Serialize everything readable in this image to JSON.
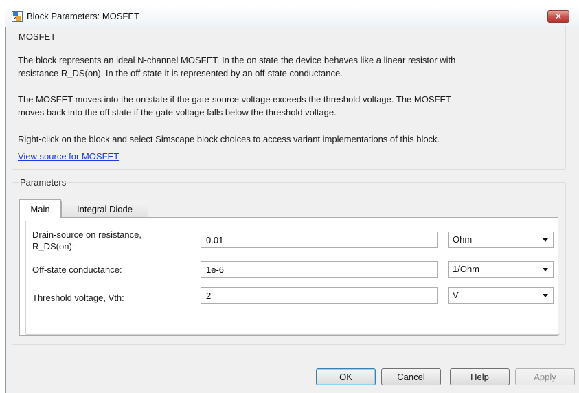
{
  "window": {
    "title": "Block Parameters: MOSFET",
    "close_label": "✕"
  },
  "description": {
    "group_title": "MOSFET",
    "paragraph1_line1": "The block represents an ideal N-channel MOSFET. In the on state the device behaves like a linear resistor with",
    "paragraph1_line2": "resistance R_DS(on). In the off state it is represented by an off-state conductance.",
    "paragraph2_line1": "The MOSFET moves into the on state if the gate-source voltage exceeds the threshold voltage. The MOSFET",
    "paragraph2_line2": "moves back into the off state if the gate voltage falls below the threshold voltage.",
    "paragraph3": "Right-click on the block and select Simscape block choices to access variant implementations of this block.",
    "link": "View source for MOSFET"
  },
  "parameters": {
    "group_title": "Parameters",
    "tabs": [
      {
        "label": "Main",
        "active": true
      },
      {
        "label": "Integral Diode",
        "active": false
      }
    ],
    "rows": [
      {
        "label_line1": "Drain-source on resistance,",
        "label_line2": "R_DS(on):",
        "value": "0.01",
        "unit": "Ohm"
      },
      {
        "label_line1": "Off-state conductance:",
        "label_line2": "",
        "value": "1e-6",
        "unit": "1/Ohm"
      },
      {
        "label_line1": "Threshold voltage, Vth:",
        "label_line2": "",
        "value": "2",
        "unit": "V"
      }
    ]
  },
  "buttons": {
    "ok": "OK",
    "cancel": "Cancel",
    "help": "Help",
    "apply": "Apply"
  },
  "colors": {
    "link": "#1a3ce0",
    "close_button": "#c75050",
    "default_button_border": "#3c7fb1"
  }
}
